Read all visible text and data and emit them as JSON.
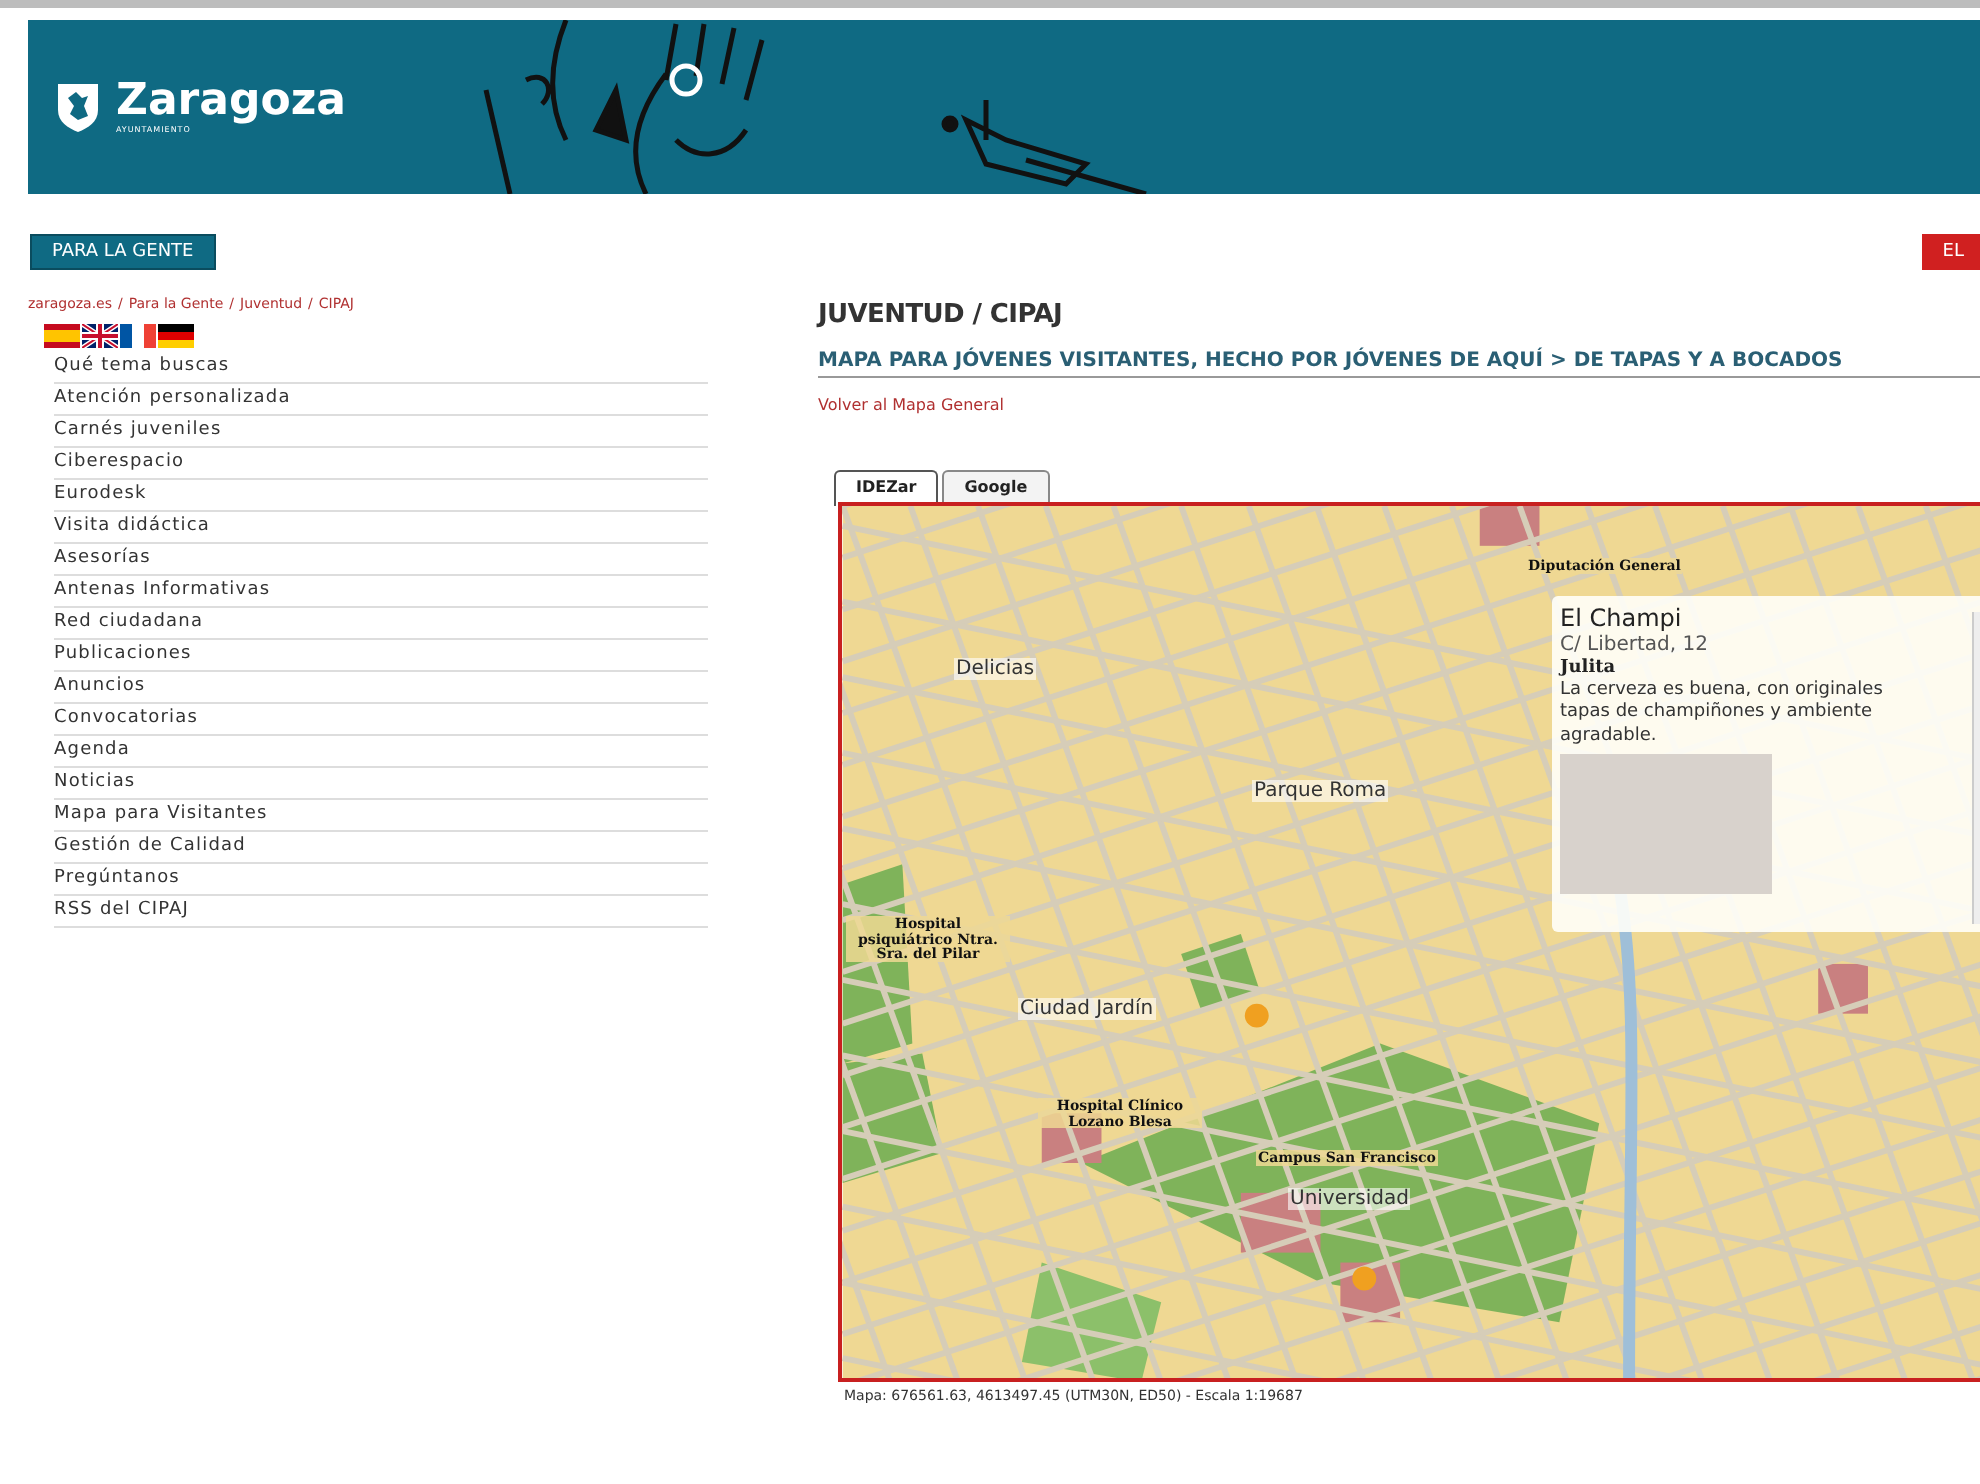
{
  "header": {
    "logo_text": "Zaragoza",
    "logo_subtext": "AYUNTAMIENTO"
  },
  "nav": {
    "section_button": "PARA LA GENTE",
    "right_button": "EL"
  },
  "breadcrumb": {
    "separator": "/",
    "links": [
      "zaragoza.es",
      "Para la Gente",
      "Juventud",
      "CIPAJ"
    ]
  },
  "sidebar": {
    "items": [
      {
        "label": "Qué tema buscas"
      },
      {
        "label": "Atención personalizada"
      },
      {
        "label": "Carnés juveniles"
      },
      {
        "label": "Ciberespacio"
      },
      {
        "label": "Eurodesk"
      },
      {
        "label": "Visita didáctica"
      },
      {
        "label": "Asesorías"
      },
      {
        "label": "Antenas Informativas"
      },
      {
        "label": "Red ciudadana"
      },
      {
        "label": "Publicaciones"
      },
      {
        "label": "Anuncios"
      },
      {
        "label": "Convocatorias"
      },
      {
        "label": "Agenda"
      },
      {
        "label": "Noticias"
      },
      {
        "label": "Mapa para Visitantes"
      },
      {
        "label": "Gestión de Calidad"
      },
      {
        "label": "Pregúntanos"
      },
      {
        "label": "RSS del CIPAJ"
      }
    ]
  },
  "content": {
    "title": "JUVENTUD / CIPAJ",
    "subtitle": "MAPA PARA JÓVENES VISITANTES, HECHO POR JÓVENES DE AQUÍ > DE TAPAS Y A BOCADOS",
    "back_link": "Volver al Mapa General"
  },
  "map": {
    "tabs": [
      {
        "label": "IDEZar",
        "selected": true
      },
      {
        "label": "Google",
        "selected": false
      }
    ],
    "labels": [
      {
        "text": "Delicias",
        "kind": "district"
      },
      {
        "text": "Parque Roma",
        "kind": "district"
      },
      {
        "text": "Ciudad Jardín",
        "kind": "district"
      },
      {
        "text": "Campus San Francisco",
        "kind": "place"
      },
      {
        "text": "Universidad",
        "kind": "district"
      },
      {
        "text": "Hospital Clínico Lozano Blesa",
        "kind": "place"
      },
      {
        "text": "Hospital psiquiátrico Ntra. Sra. del Pilar",
        "kind": "place"
      },
      {
        "text": "Diputación General",
        "kind": "place"
      }
    ],
    "popup": {
      "title": "El Champi",
      "address": "C/ Libertad, 12",
      "author": "Julita",
      "description": "La cerveza es buena, con originales tapas de champiñones y ambiente agradable."
    },
    "footer": "Mapa: 676561.63, 4613497.45 (UTM30N, ED50) - Escala 1:19687"
  }
}
